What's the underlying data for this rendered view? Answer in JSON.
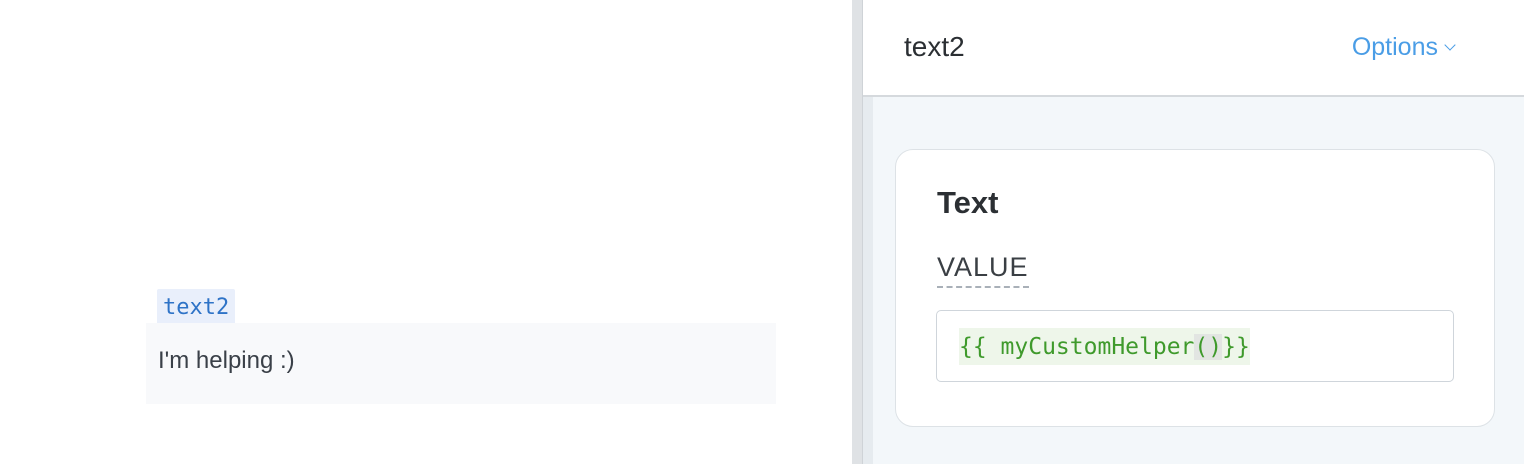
{
  "canvas": {
    "component_name": "text2",
    "text_value": "I'm helping :)"
  },
  "inspector": {
    "title": "text2",
    "options_label": "Options",
    "card": {
      "title": "Text",
      "field_label": "VALUE",
      "code_before": "{{ myCustomHelper",
      "code_parens": "()",
      "code_after": "}}"
    }
  },
  "colors": {
    "accent": "#4a9de6",
    "code_green": "#3f9a2c",
    "tag_blue": "#2e73c7"
  }
}
